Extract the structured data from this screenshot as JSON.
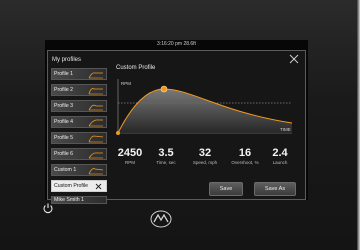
{
  "statusbar": {
    "text": "3:16:20 pm 28.6ft"
  },
  "sidebar": {
    "title": "My profiles",
    "items": [
      {
        "label": "Profile 1",
        "icon": "curve-icon"
      },
      {
        "label": "Profile 2",
        "icon": "curve-icon"
      },
      {
        "label": "Profile 3",
        "icon": "curve-icon"
      },
      {
        "label": "Profile 4",
        "icon": "curve-icon"
      },
      {
        "label": "Profile 5",
        "icon": "curve-icon"
      },
      {
        "label": "Profile 6",
        "icon": "curve-icon"
      },
      {
        "label": "Custom 1",
        "icon": "curve-icon"
      },
      {
        "label": "Custom Profile",
        "icon": "close-icon",
        "selected": true
      },
      {
        "label": "Mike Smith 1",
        "icon": "curve-icon"
      }
    ]
  },
  "main": {
    "title": "Custom Profile",
    "chart": {
      "ylabel": "RPM",
      "xlabel": "TIME"
    },
    "stats": [
      {
        "value": "2450",
        "label": "RPM"
      },
      {
        "value": "3.5",
        "label": "Time, sec"
      },
      {
        "value": "32",
        "label": "Speed, mph"
      },
      {
        "value": "16",
        "label": "Overshoot, %"
      },
      {
        "value": "2.4",
        "label": "Launch"
      }
    ],
    "buttons": {
      "save": "Save",
      "save_as": "Save As"
    }
  },
  "colors": {
    "accent": "#f39a1d",
    "background": "#161616"
  }
}
